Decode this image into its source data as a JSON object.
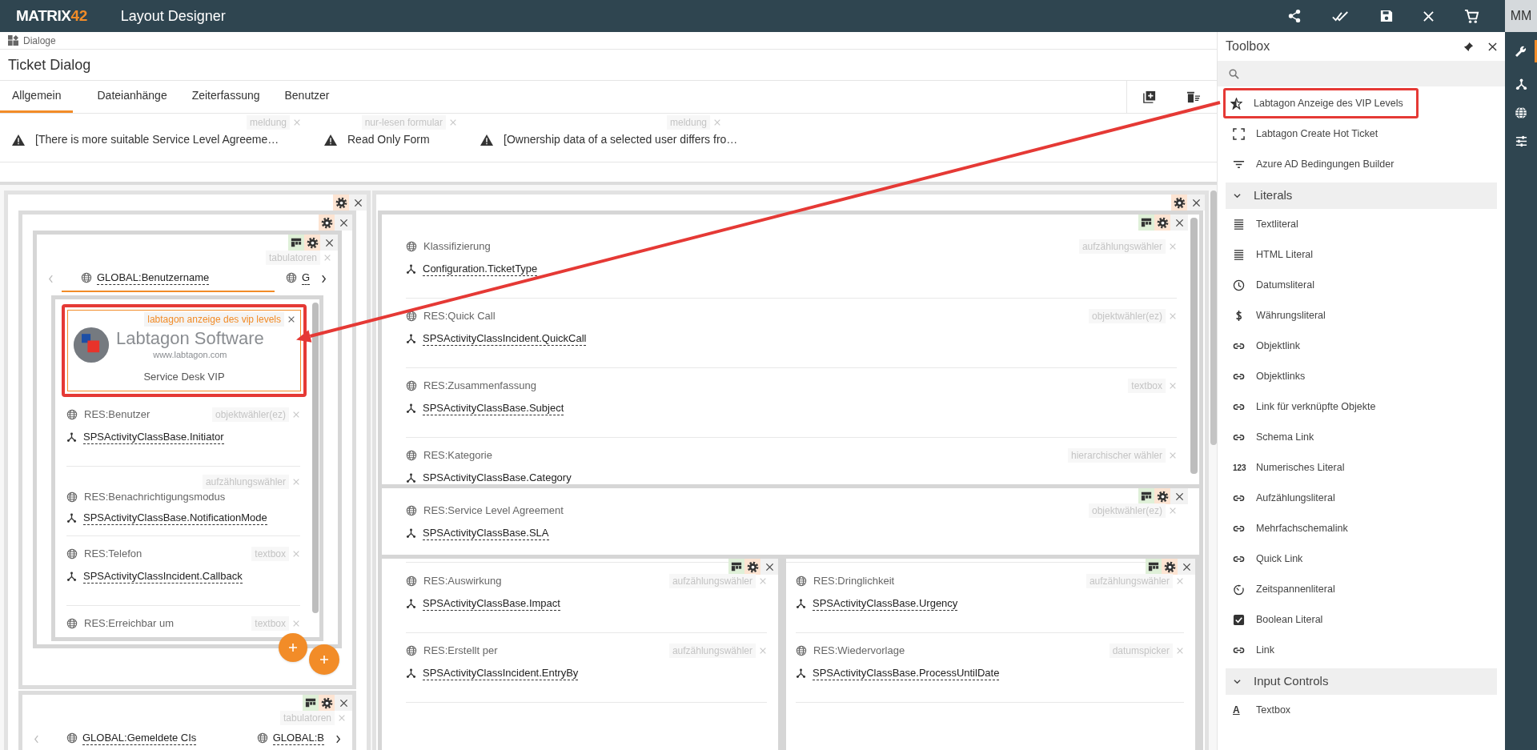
{
  "app": {
    "logo_text": "MATRIX",
    "logo_number": "42",
    "title": "Layout Designer",
    "avatar": "MM"
  },
  "breadcrumb": "Dialoge",
  "dialog_title": "Ticket Dialog",
  "tabs": [
    {
      "label": "Allgemein",
      "selected": true
    },
    {
      "label": "Dateianhänge",
      "selected": false
    },
    {
      "label": "Zeiterfassung",
      "selected": false
    },
    {
      "label": "Benutzer",
      "selected": false
    }
  ],
  "messages": [
    {
      "text": "[There is more suitable Service Level Agreeme…",
      "tag": "meldung"
    },
    {
      "text": "Read Only Form",
      "tag": "nur-lesen formular"
    },
    {
      "text": "[Ownership data of a selected user differs fro…",
      "tag": "meldung"
    }
  ],
  "canvas": {
    "left_tabs": {
      "tag": "tabulatoren",
      "tabs": [
        {
          "label": "GLOBAL:Benutzername",
          "selected": true
        },
        {
          "label": "G",
          "selected": false
        }
      ]
    },
    "vip_widget": {
      "tag": "labtagon anzeige des vip levels",
      "logo_name": "Labtagon Software",
      "logo_url": "www.labtagon.com",
      "caption": "Service Desk VIP",
      "highlighted": true
    },
    "left_fields": [
      {
        "label": "RES:Benutzer",
        "binding": "SPSActivityClassBase.Initiator",
        "tag": "objektwähler(ez)"
      },
      {
        "label": "RES:Benachrichtigungsmodus",
        "binding": "SPSActivityClassBase.NotificationMode",
        "tag": "aufzählungswähler"
      },
      {
        "label": "RES:Telefon",
        "binding": "SPSActivityClassIncident.Callback",
        "tag": "textbox"
      },
      {
        "label": "RES:Erreichbar um",
        "tag": "textbox"
      }
    ],
    "lower_tabs": {
      "tag": "tabulatoren",
      "tabs": [
        {
          "label": "GLOBAL:Gemeldete CIs"
        },
        {
          "label": "GLOBAL:B"
        }
      ]
    },
    "main_fields": [
      {
        "label": "Klassifizierung",
        "binding": "Configuration.TicketType",
        "tag": "aufzählungswähler"
      },
      {
        "label": "RES:Quick Call",
        "binding": "SPSActivityClassIncident.QuickCall",
        "tag": "objektwähler(ez)"
      },
      {
        "label": "RES:Zusammenfassung",
        "binding": "SPSActivityClassBase.Subject",
        "tag": "textbox"
      },
      {
        "label": "RES:Kategorie",
        "binding": "SPSActivityClassBase.Category",
        "tag": "hierarchischer wähler"
      }
    ],
    "sla_fields": [
      {
        "label": "RES:Service Level Agreement",
        "binding": "SPSActivityClassBase.SLA",
        "tag": "objektwähler(ez)"
      }
    ],
    "bottom_left_fields": [
      {
        "label": "RES:Auswirkung",
        "binding": "SPSActivityClassBase.Impact",
        "tag": "aufzählungswähler"
      },
      {
        "label": "RES:Erstellt per",
        "binding": "SPSActivityClassIncident.EntryBy",
        "tag": "aufzählungswähler"
      }
    ],
    "bottom_right_fields": [
      {
        "label": "RES:Dringlichkeit",
        "binding": "SPSActivityClassBase.Urgency",
        "tag": "aufzählungswähler"
      },
      {
        "label": "RES:Wiedervorlage",
        "binding": "SPSActivityClassBase.ProcessUntilDate",
        "tag": "datumspicker"
      }
    ]
  },
  "toolbox": {
    "title": "Toolbox",
    "groups": [
      {
        "items": [
          {
            "label": "Labtagon Anzeige des VIP Levels",
            "kind": "star",
            "highlighted": true
          },
          {
            "label": "Labtagon Create Hot Ticket",
            "kind": "frame",
            "highlighted": false
          },
          {
            "label": "Azure AD Bedingungen Builder",
            "kind": "filter",
            "highlighted": false
          }
        ]
      },
      {
        "title": "Literals",
        "expanded": true,
        "items": [
          {
            "label": "Textliteral",
            "kind": "lines",
            "highlighted": false
          },
          {
            "label": "HTML Literal",
            "kind": "lines",
            "highlighted": false
          },
          {
            "label": "Datumsliteral",
            "kind": "clock",
            "highlighted": false
          },
          {
            "label": "Währungsliteral",
            "kind": "currency",
            "highlighted": false
          },
          {
            "label": "Objektlink",
            "kind": "link",
            "highlighted": false
          },
          {
            "label": "Objektlinks",
            "kind": "link",
            "highlighted": false
          },
          {
            "label": "Link für verknüpfte Objekte",
            "kind": "link",
            "highlighted": false
          },
          {
            "label": "Schema Link",
            "kind": "link",
            "highlighted": false
          },
          {
            "label": "Numerisches Literal",
            "kind": "glyph",
            "icon_text": "123",
            "highlighted": false
          },
          {
            "label": "Aufzählungsliteral",
            "kind": "link",
            "highlighted": false
          },
          {
            "label": "Mehrfachschemalink",
            "kind": "link",
            "highlighted": false
          },
          {
            "label": "Quick Link",
            "kind": "link",
            "highlighted": false
          },
          {
            "label": "Zeitspannenliteral",
            "kind": "timer",
            "highlighted": false
          },
          {
            "label": "Boolean Literal",
            "kind": "checkbox",
            "highlighted": false
          },
          {
            "label": "Link",
            "kind": "link",
            "highlighted": false
          }
        ]
      },
      {
        "title": "Input Controls",
        "expanded": true,
        "items": [
          {
            "label": "Textbox",
            "kind": "glyph",
            "icon_text": "A",
            "highlighted": false
          }
        ]
      }
    ]
  }
}
